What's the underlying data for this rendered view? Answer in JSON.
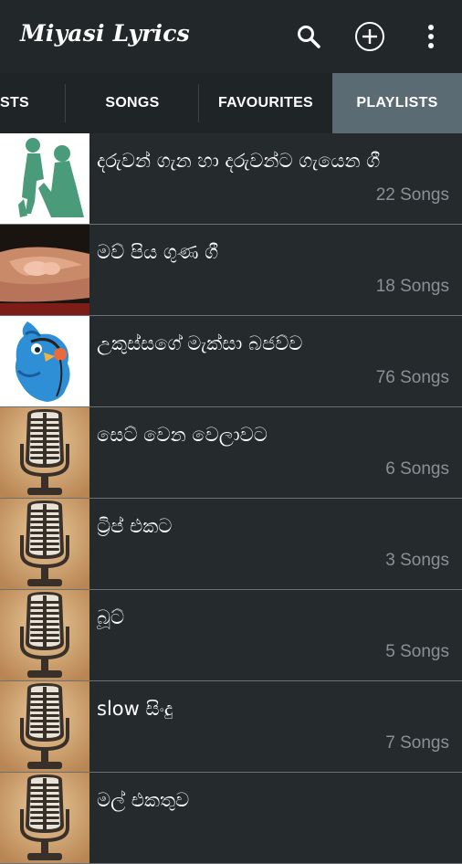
{
  "app": {
    "title": "Miyasi Lyrics"
  },
  "toolbar": {
    "search_icon": "search-icon",
    "add_icon": "add-circle-icon",
    "menu_icon": "overflow-menu-icon"
  },
  "tabs": [
    {
      "label": "STS",
      "active": false
    },
    {
      "label": "SONGS",
      "active": false
    },
    {
      "label": "FAVOURITES",
      "active": false
    },
    {
      "label": "PLAYLISTS",
      "active": true
    }
  ],
  "playlists": [
    {
      "name": "දරුවන් ගැන හා දරුවන්ට ගැයෙන ගී",
      "count": "22 Songs",
      "thumb": "mother-child-silhouette"
    },
    {
      "name": "මව් පිය ගුණ ගී",
      "count": "18 Songs",
      "thumb": "holding-hands"
    },
    {
      "name": "උකුස්සගේ මැක්සා බජව්ව",
      "count": "76 Songs",
      "thumb": "blue-bird-headphones"
    },
    {
      "name": "සෙට් වෙන වෙලාවට",
      "count": "6 Songs",
      "thumb": "microphone"
    },
    {
      "name": "ට්‍රිප් එකට",
      "count": "3 Songs",
      "thumb": "microphone"
    },
    {
      "name": "බූට්",
      "count": "5 Songs",
      "thumb": "microphone"
    },
    {
      "name": "slow සිංදු",
      "count": "7 Songs",
      "thumb": "microphone"
    },
    {
      "name": "මල් එකතුව",
      "count": "",
      "thumb": "microphone"
    }
  ],
  "colors": {
    "appbar": "#22272a",
    "tabs": "#1f2427",
    "active_tab": "#5a6b73",
    "list_bg": "#252a2d",
    "divider": "#6b7175",
    "count_text": "#8a9094"
  }
}
